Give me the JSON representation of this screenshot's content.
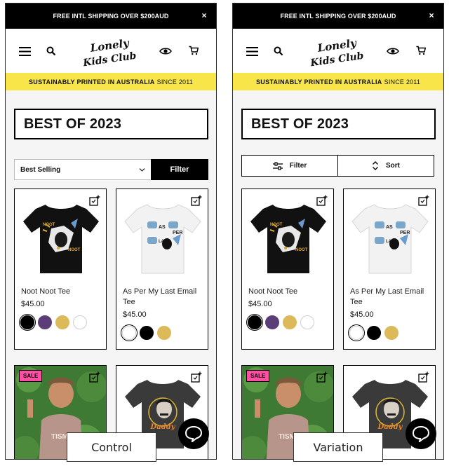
{
  "promo": {
    "text": "FREE INTL SHIPPING OVER $200AUD",
    "close": "×"
  },
  "brand": {
    "logo_text": "Lonely Kids Club"
  },
  "tagline": {
    "main": "SUSTAINABLY PRINTED IN AUSTRALIA",
    "since": "SINCE 2011"
  },
  "page_title": "BEST OF 2023",
  "control": {
    "sort_value": "Best Selling",
    "filter_label": "Filter",
    "caption": "Control"
  },
  "variation": {
    "filter_label": "Filter",
    "sort_label": "Sort",
    "caption": "Variation"
  },
  "products": [
    {
      "name": "Noot Noot Tee",
      "price": "$45.00",
      "swatches": [
        "black",
        "purple",
        "gold",
        "white"
      ]
    },
    {
      "name": "As Per My Last Email Tee",
      "price": "$45.00",
      "swatches": [
        "white",
        "black",
        "gold"
      ]
    },
    {
      "badge": "SALE"
    },
    {
      "print_text": "Daddy"
    }
  ],
  "colors": {
    "tagline_bg": "#f7e54a",
    "sale_badge": "#ff4fa5",
    "promo_bg": "#000000"
  }
}
